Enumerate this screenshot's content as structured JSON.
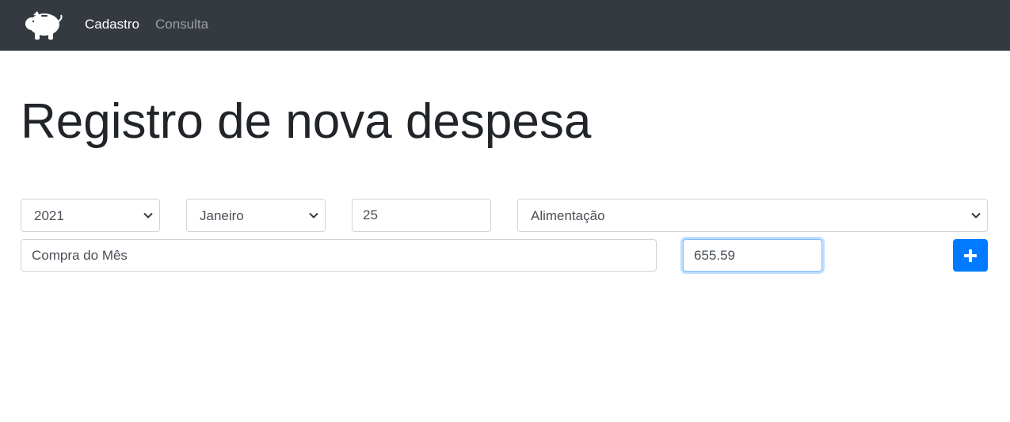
{
  "nav": {
    "brand_icon": "piggy-bank-icon",
    "links": [
      {
        "label": "Cadastro",
        "active": true
      },
      {
        "label": "Consulta",
        "active": false
      }
    ]
  },
  "page": {
    "title": "Registro de nova despesa"
  },
  "form": {
    "ano": {
      "selected": "2021"
    },
    "mes": {
      "selected": "Janeiro"
    },
    "dia": {
      "value": "25"
    },
    "tipo": {
      "selected": "Alimentação"
    },
    "descricao": {
      "value": "Compra do Mês"
    },
    "valor": {
      "value": "655.59",
      "focused": true
    },
    "add_button": {
      "icon": "plus-icon"
    }
  },
  "colors": {
    "navbar_bg": "#343a40",
    "primary": "#007bff",
    "focus_border": "#80bdff"
  }
}
